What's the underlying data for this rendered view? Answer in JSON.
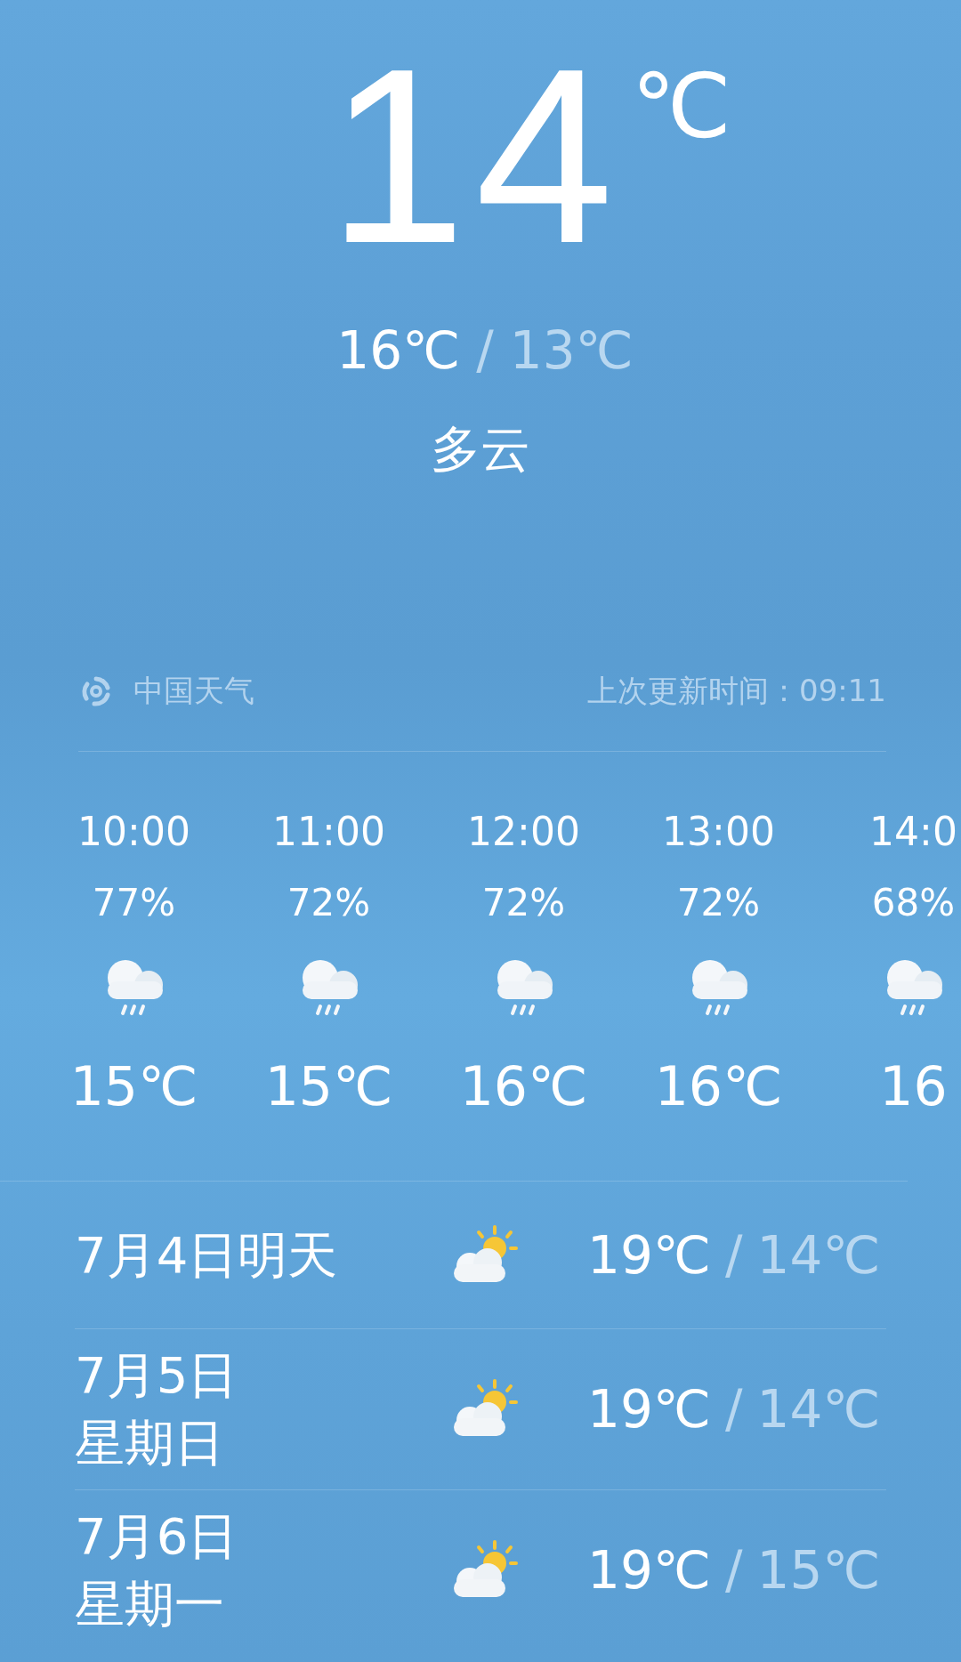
{
  "current": {
    "temperature": "14",
    "unit": "℃",
    "high": "16℃",
    "separator": "/",
    "low": "13℃",
    "condition": "多云"
  },
  "source": {
    "name": "中国天气",
    "updated": "上次更新时间：09:11"
  },
  "hourly": [
    {
      "time": "10:00",
      "humidity": "77%",
      "kind": "rain",
      "temperature": "15℃"
    },
    {
      "time": "11:00",
      "humidity": "72%",
      "kind": "rain",
      "temperature": "15℃"
    },
    {
      "time": "12:00",
      "humidity": "72%",
      "kind": "rain",
      "temperature": "16℃"
    },
    {
      "time": "13:00",
      "humidity": "72%",
      "kind": "rain",
      "temperature": "16℃"
    },
    {
      "time": "14:0",
      "humidity": "68%",
      "kind": "rain",
      "temperature": "16"
    }
  ],
  "daily": [
    {
      "date": [
        "7月4日明天"
      ],
      "kind": "partly_cloudy",
      "high": "19℃",
      "separator": "/",
      "low": "14℃"
    },
    {
      "date": [
        "7月5日",
        "星期日"
      ],
      "kind": "partly_cloudy",
      "high": "19℃",
      "separator": "/",
      "low": "14℃"
    },
    {
      "date": [
        "7月6日",
        "星期一"
      ],
      "kind": "partly_cloudy",
      "high": "19℃",
      "separator": "/",
      "low": "15℃"
    }
  ]
}
